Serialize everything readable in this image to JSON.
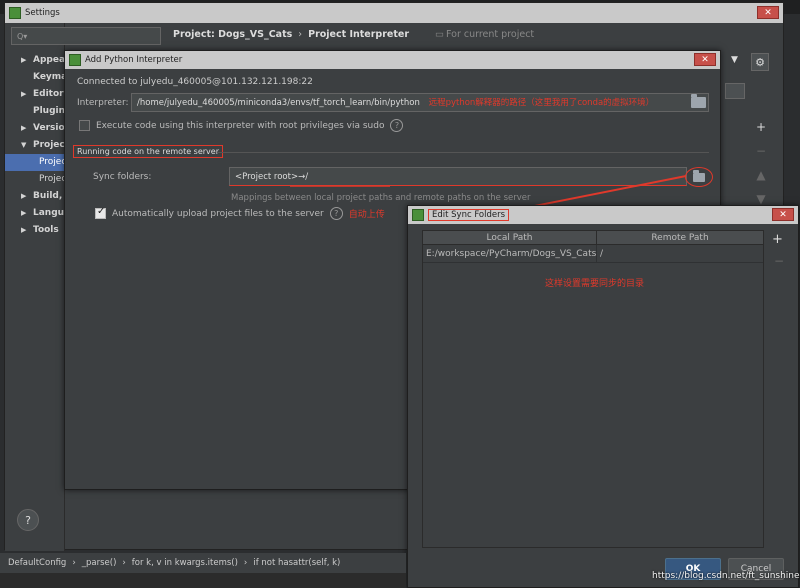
{
  "settings": {
    "title": "Settings",
    "search_placeholder": "Q▾",
    "breadcrumb": {
      "project": "Project: Dogs_VS_Cats",
      "separator": "›",
      "page": "Project Interpreter",
      "hint": "For current project"
    },
    "sidebar": [
      {
        "label": "Appeara",
        "arrow": "▶",
        "bold": true
      },
      {
        "label": "Keymap",
        "arrow": "",
        "bold": true
      },
      {
        "label": "Editor",
        "arrow": "▶",
        "bold": true
      },
      {
        "label": "Plugins",
        "arrow": "",
        "bold": true
      },
      {
        "label": "Version",
        "arrow": "▶",
        "bold": true
      },
      {
        "label": "Project:",
        "arrow": "▼",
        "bold": true
      },
      {
        "label": "Projec",
        "arrow": "",
        "bold": false,
        "selected": true,
        "indent": true
      },
      {
        "label": "Projec",
        "arrow": "",
        "bold": false,
        "indent": true
      },
      {
        "label": "Build, E",
        "arrow": "▶",
        "bold": true
      },
      {
        "label": "Languag",
        "arrow": "▶",
        "bold": true
      },
      {
        "label": "Tools",
        "arrow": "▶",
        "bold": true
      }
    ],
    "help_label": "?",
    "right_tools": [
      "+",
      "−",
      "▲",
      "▼",
      "👁"
    ]
  },
  "add_interpreter": {
    "title": "Add Python Interpreter",
    "connected_label": "Connected to julyedu_460005@101.132.121.198:22",
    "interpreter_label": "Interpreter:",
    "interpreter_value": "/home/julyedu_460005/miniconda3/envs/tf_torch_learn/bin/python",
    "interpreter_note": "远程python解释器的路径（这里我用了conda的虚拟环境）",
    "sudo_label": "Execute code using this interpreter with root privileges via sudo",
    "section_title": "Running code on the remote server",
    "sync_label": "Sync folders:",
    "sync_value": "<Project root>→/",
    "sync_hint": "Mappings between local project paths and remote paths on the server",
    "auto_upload_label": "Automatically upload project files to the server",
    "auto_upload_note": "自动上传"
  },
  "edit_sync": {
    "title": "Edit Sync Folders",
    "columns": [
      "Local Path",
      "Remote Path"
    ],
    "rows": [
      {
        "local": "E:/workspace/PyCharm/Dogs_VS_Cats",
        "remote": "/"
      }
    ],
    "note": "这样设置需要同步的目录",
    "ok_label": "OK",
    "cancel_label": "Cancel",
    "add": "+",
    "remove": "−"
  },
  "statusbar": {
    "crumbs": [
      "DefaultConfig",
      "_parse()",
      "for k, v in kwargs.items()",
      "if not hasattr(self, k)"
    ],
    "sep": "›"
  },
  "watermark": "https://blog.csdn.net/ft_sunshine",
  "colors": {
    "accent": "#4b6eaf",
    "annotation": "#e0392b"
  }
}
